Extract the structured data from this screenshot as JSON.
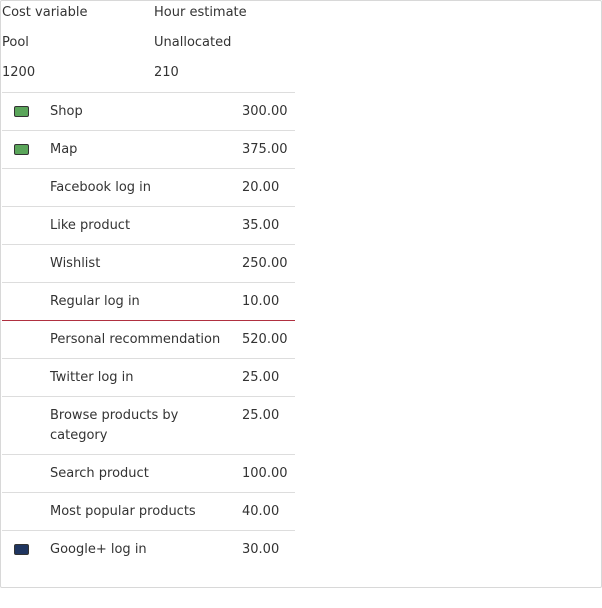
{
  "summary": {
    "headers": [
      "Cost variable",
      "Hour estimate"
    ],
    "rows": [
      [
        "Pool",
        "Unallocated"
      ],
      [
        "1200",
        "210"
      ]
    ]
  },
  "items": [
    {
      "label": "Shop",
      "value": "300.00",
      "swatch": "#5aa55a"
    },
    {
      "label": "Map",
      "value": "375.00",
      "swatch": "#5aa55a"
    },
    {
      "label": "Facebook log in",
      "value": "20.00"
    },
    {
      "label": "Like product",
      "value": "35.00"
    },
    {
      "label": "Wishlist",
      "value": "250.00"
    },
    {
      "label": "Regular log in",
      "value": "10.00"
    },
    {
      "label": "Personal recommendation",
      "value": "520.00"
    },
    {
      "label": "Twitter log in",
      "value": "25.00"
    },
    {
      "label": "Browse products by category",
      "value": "25.00"
    },
    {
      "label": "Search product",
      "value": "100.00"
    },
    {
      "label": "Most popular products",
      "value": "40.00"
    },
    {
      "label": "Google+ log in",
      "value": "30.00",
      "swatch": "#1f3560"
    }
  ],
  "colors": {
    "divider_line": "#b03040",
    "border": "#dddddd"
  }
}
